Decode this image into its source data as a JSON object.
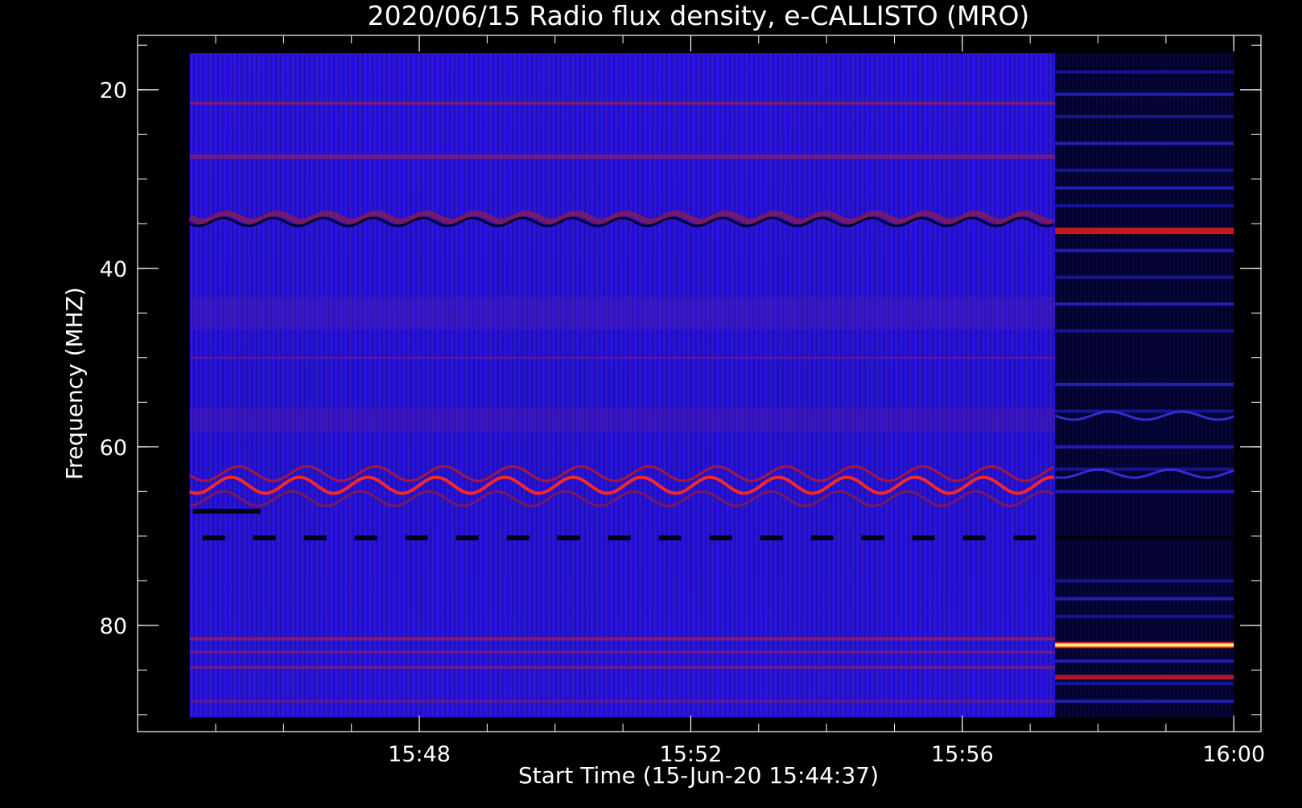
{
  "chart_data": {
    "type": "heatmap",
    "title": "2020/06/15  Radio flux density, e-CALLISTO (MRO)",
    "xlabel": "Start Time (15-Jun-20 15:44:37)",
    "ylabel": "Frequency (MHZ)",
    "x_tick_labels": [
      "15:48",
      "15:52",
      "15:56",
      "16:00"
    ],
    "x_ticks_minutes": [
      3.383,
      7.383,
      11.383,
      15.383
    ],
    "x_minor_every_minutes": 1,
    "xlim_minutes": [
      -0.767,
      15.783
    ],
    "data_x_minutes": [
      0,
      15.383
    ],
    "second_segment_start_minutes": 12.75,
    "y_tick_labels": [
      "20",
      "40",
      "60",
      "80"
    ],
    "y_ticks": [
      20,
      40,
      60,
      80
    ],
    "y_minor_every": 5,
    "ylim": [
      13.9,
      91.9
    ],
    "data_freq_range": [
      15.9,
      90.3
    ],
    "reversed_y": true,
    "features": [
      {
        "name": "band_20",
        "freq": 21.2,
        "intensity": 0.35
      },
      {
        "name": "band_27",
        "freq": 27.6,
        "intensity": 0.45
      },
      {
        "name": "wavy_dark",
        "freq": 34.5,
        "intensity": -0.6
      },
      {
        "name": "band_50",
        "freq": 50.0,
        "intensity": 0.3
      },
      {
        "name": "wavy_bright",
        "freq": 64.0,
        "intensity": 0.85
      },
      {
        "name": "dashed_dark",
        "freq": 70.2,
        "intensity": -0.9
      },
      {
        "name": "band_82",
        "freq": 82.0,
        "intensity": 0.5
      },
      {
        "name": "late_bright",
        "freq": 82.3,
        "intensity": 1.0
      },
      {
        "name": "late_red",
        "freq": 35.8,
        "intensity": 0.7
      }
    ],
    "colors": {
      "background": "#000000",
      "low": "#000030",
      "mid": "#1a10e8",
      "high": "#c01818",
      "peak": "#fff070",
      "axis": "#ffffff"
    }
  }
}
